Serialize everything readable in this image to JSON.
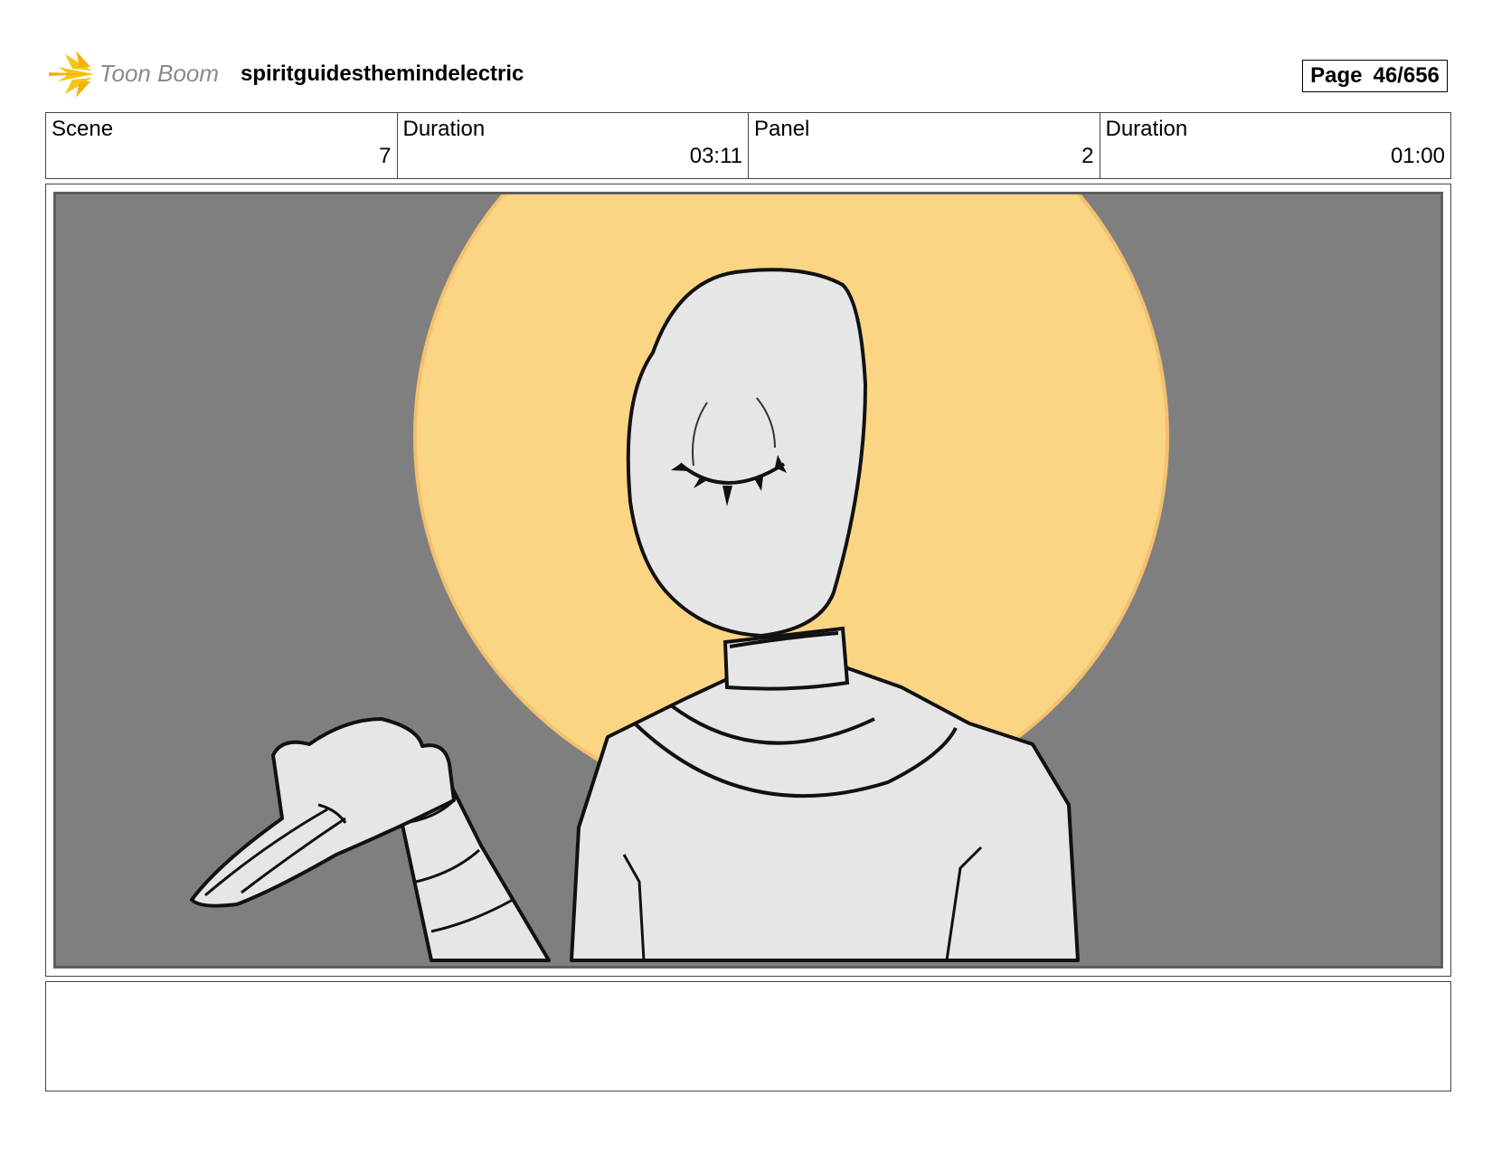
{
  "header": {
    "logo_text": "Toon Boom",
    "project_title": "spiritguidesthemindelectric",
    "page_label": "Page",
    "page_number": "46/656"
  },
  "info": {
    "scene_label": "Scene",
    "scene_value": "7",
    "scene_duration_label": "Duration",
    "scene_duration_value": "03:11",
    "panel_label": "Panel",
    "panel_value": "2",
    "panel_duration_label": "Duration",
    "panel_duration_value": "01:00"
  },
  "colors": {
    "background": "#7f7f7f",
    "halo": "#fcd584",
    "figure": "#e6e6e6",
    "logo_accent": "#f5c518"
  },
  "notes": ""
}
